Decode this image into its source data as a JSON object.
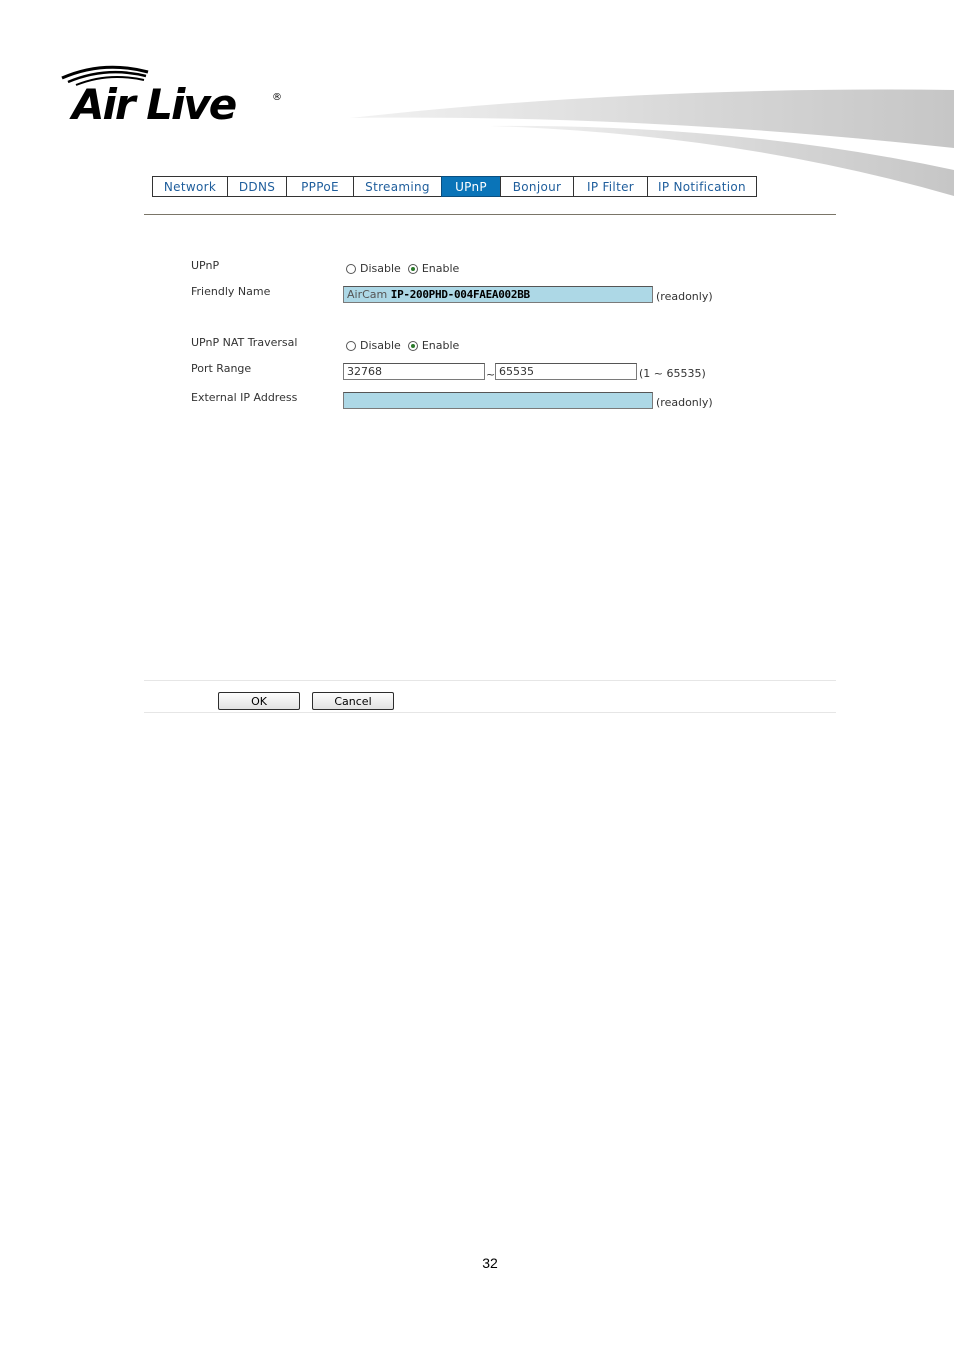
{
  "brand": {
    "logo_text": "Air Live",
    "registered": "®"
  },
  "tabs": [
    {
      "label": "Network",
      "active": false
    },
    {
      "label": "DDNS",
      "active": false
    },
    {
      "label": "PPPoE",
      "active": false
    },
    {
      "label": "Streaming",
      "active": false
    },
    {
      "label": "UPnP",
      "active": true
    },
    {
      "label": "Bonjour",
      "active": false
    },
    {
      "label": "IP Filter",
      "active": false
    },
    {
      "label": "IP Notification",
      "active": false
    }
  ],
  "form": {
    "upnp": {
      "label": "UPnP",
      "disable": "Disable",
      "enable": "Enable",
      "selected": "Enable"
    },
    "friendly_name": {
      "label": "Friendly Name",
      "prefix": "AirCam",
      "value": "IP-200PHD-004FAEA002BB",
      "note": "(readonly)"
    },
    "nat_traversal": {
      "label": "UPnP NAT Traversal",
      "disable": "Disable",
      "enable": "Enable",
      "selected": "Enable"
    },
    "port_range": {
      "label": "Port Range",
      "from": "32768",
      "separator": "~",
      "to": "65535",
      "note": "(1 ~ 65535)"
    },
    "external_ip": {
      "label": "External IP Address",
      "value": "",
      "note": "(readonly)"
    }
  },
  "buttons": {
    "ok": "OK",
    "cancel": "Cancel"
  },
  "page_number": "32",
  "colors": {
    "active_tab": "#0a74b8",
    "tab_text": "#1f5e9c",
    "readonly_field": "#add8e6"
  }
}
